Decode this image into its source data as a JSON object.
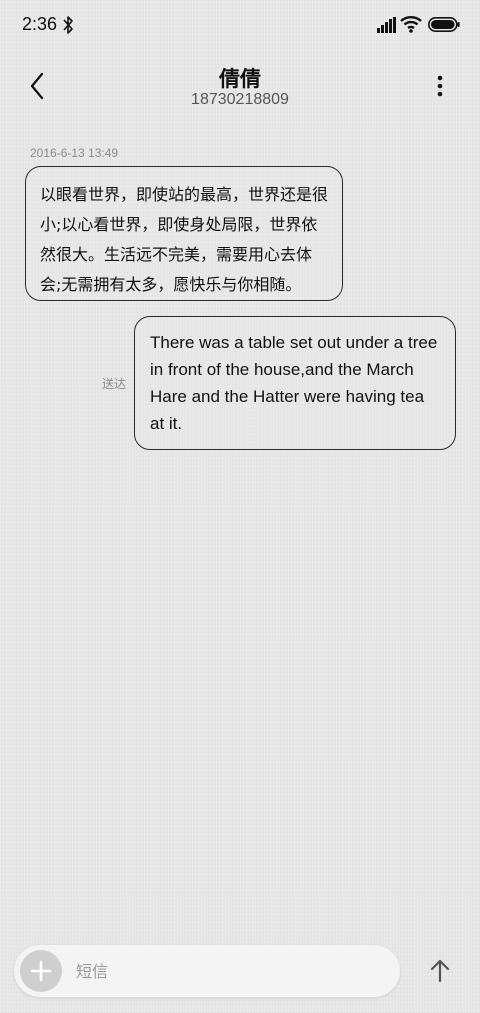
{
  "status_bar": {
    "time": "2:36",
    "icons": [
      "bluetooth-icon",
      "signal-icon",
      "wifi-icon",
      "battery-icon"
    ]
  },
  "header": {
    "contact_name": "倩倩",
    "contact_number": "18730218809",
    "back_icon": "chevron-left-icon",
    "more_icon": "more-vertical-icon"
  },
  "conversation": {
    "timestamp": "2016-6-13 13:49",
    "received_message": {
      "lines": [
        "以眼看世界，即使站的最高，世界还是很",
        "小;以心看世界，即使身处局限，世界依",
        "然很大。生活远不完美，需要用心去体",
        "会;无需拥有太多，愿快乐与你相随。"
      ]
    },
    "sent_message": {
      "lines": [
        "There was a table set out under a tree",
        "in front of the house,and the March",
        "Hare and the Hatter were having tea",
        "at it."
      ],
      "status": "送达"
    }
  },
  "composer": {
    "placeholder": "短信",
    "value": "",
    "add_icon": "plus-icon",
    "send_icon": "arrow-up-icon"
  },
  "colors": {
    "background": "#e8e8e8",
    "bubble_border": "#2a2a2a",
    "muted_text": "#8a8a8a",
    "input_bg": "#f4f4f4",
    "add_button_bg": "#cfcfcf"
  }
}
